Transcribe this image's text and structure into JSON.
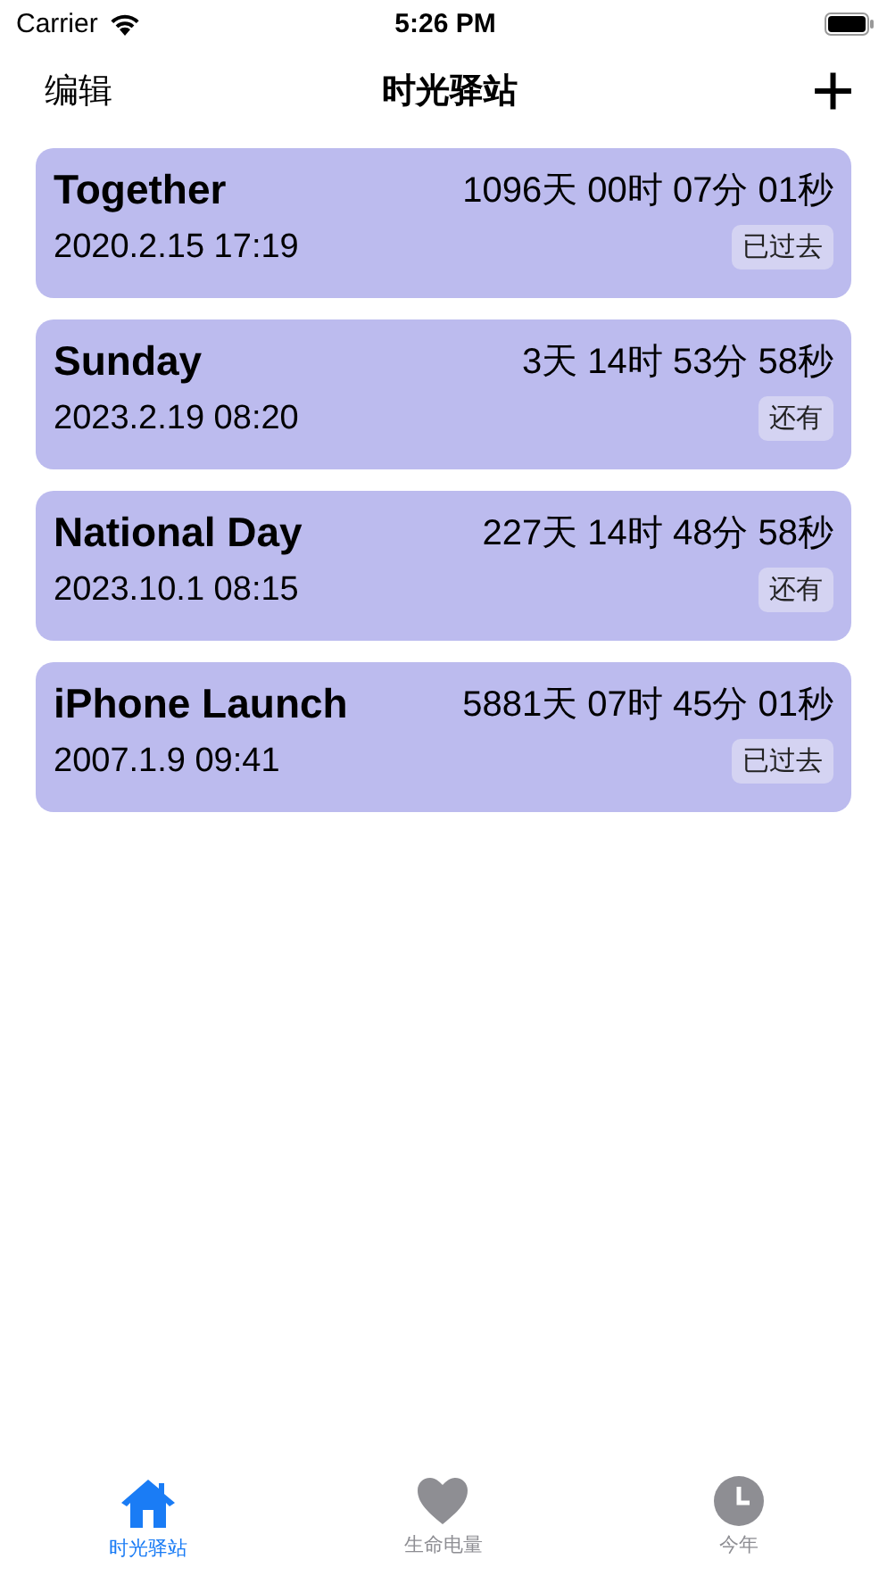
{
  "status_bar": {
    "carrier": "Carrier",
    "time": "5:26 PM"
  },
  "nav": {
    "left": "编辑",
    "title": "时光驿站",
    "right": "+"
  },
  "events": [
    {
      "title": "Together",
      "countdown": "1096天 00时 07分 01秒",
      "date": "2020.2.15  17:19",
      "status": "已过去"
    },
    {
      "title": "Sunday",
      "countdown": "3天 14时 53分 58秒",
      "date": "2023.2.19  08:20",
      "status": "还有"
    },
    {
      "title": "National Day",
      "countdown": "227天 14时 48分 58秒",
      "date": "2023.10.1  08:15",
      "status": "还有"
    },
    {
      "title": "iPhone Launch",
      "countdown": "5881天 07时 45分 01秒",
      "date": "2007.1.9  09:41",
      "status": "已过去"
    }
  ],
  "tabs": [
    {
      "kind": "home",
      "label": "时光驿站",
      "selected": true
    },
    {
      "kind": "heart",
      "label": "生命电量",
      "selected": false
    },
    {
      "kind": "clock",
      "label": "今年",
      "selected": false
    }
  ]
}
